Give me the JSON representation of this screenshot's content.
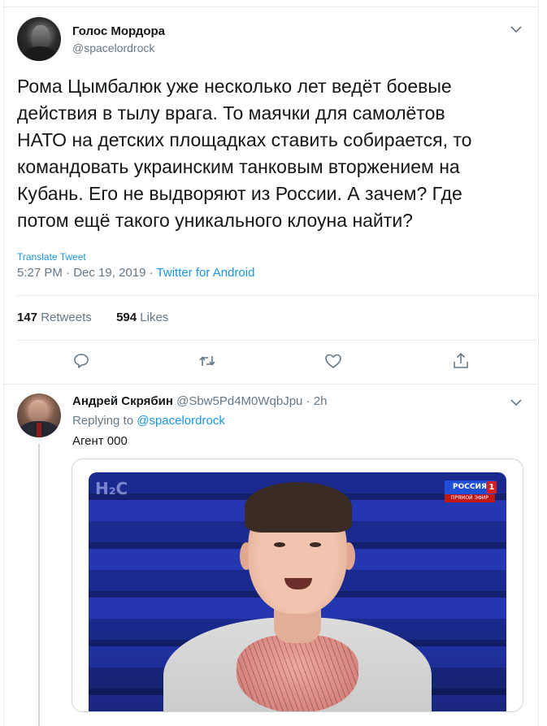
{
  "tweet": {
    "author_name": "Голос Мордора",
    "author_handle": "@spacelordrock",
    "text_lines": [
      "Рома Цымбалюк уже несколько лет ведёт боевые",
      "действия в тылу врага. То маячки для самолётов",
      "НАТО на детских площадках ставить собирается, то",
      "командовать украинским танковым вторжением на",
      "Кубань. Его не выдворяют из России. А зачем? Где",
      "потом ещё такого уникального клоуна найти?"
    ],
    "translate_label": "Translate Tweet",
    "time": "5:27 PM",
    "date": "Dec 19, 2019",
    "separator": "·",
    "source": "Twitter for Android",
    "retweets_count": "147",
    "retweets_label": "Retweets",
    "likes_count": "594",
    "likes_label": "Likes",
    "actions": [
      "reply-icon",
      "retweet-icon",
      "like-icon",
      "share-icon"
    ]
  },
  "reply": {
    "author_name": "Андрей Скрябин",
    "author_handle": "@Sbw5Pd4M0WqbJpu",
    "separator": "·",
    "time_ago": "2h",
    "replying_prefix": "Replying to",
    "replying_to": "@spacelordrock",
    "text": "Агент 000",
    "media": {
      "tv_logo_left": "H₂C",
      "channel_name": "РОССИЯ",
      "channel_number": "1",
      "live_label": "ПРЯМОЙ ЭФИР"
    }
  },
  "colors": {
    "link": "#1b95e0",
    "secondary_text": "#657786",
    "primary_text": "#14171a",
    "divider": "#e6ecf0"
  }
}
